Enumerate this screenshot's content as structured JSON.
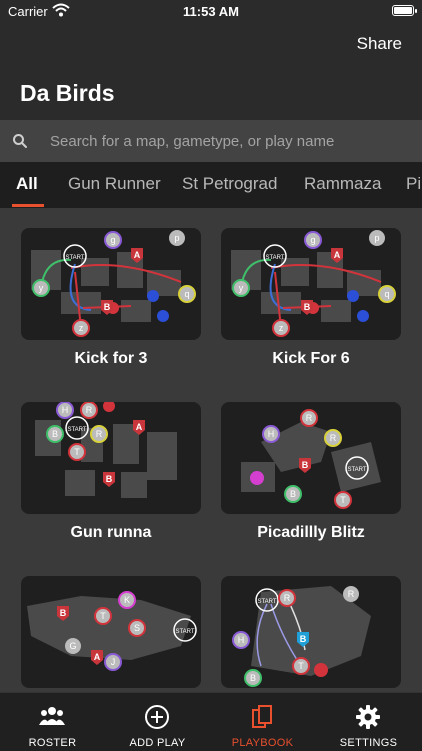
{
  "status_bar": {
    "carrier": "Carrier",
    "time": "11:53 AM",
    "battery_level": 0.9
  },
  "header": {
    "share_label": "Share",
    "title": "Da Birds"
  },
  "search": {
    "placeholder": "Search for a map, gametype, or play name"
  },
  "tabs": [
    {
      "label": "All",
      "active": true
    },
    {
      "label": "Gun Runner"
    },
    {
      "label": "St Petrograd"
    },
    {
      "label": "Rammaza"
    },
    {
      "label": "Pi"
    }
  ],
  "plays": [
    {
      "name": "Kick for 3",
      "markers": [
        "START",
        "A",
        "B",
        "g",
        "p",
        "q",
        "y",
        "z"
      ]
    },
    {
      "name": "Kick For 6",
      "markers": [
        "START",
        "A",
        "B",
        "g",
        "p",
        "q",
        "y",
        "z"
      ]
    },
    {
      "name": "Gun runna",
      "markers": [
        "H",
        "R",
        "START",
        "B",
        "T",
        "R",
        "A",
        "B"
      ]
    },
    {
      "name": "Picadillly Blitz",
      "markers": [
        "R",
        "H",
        "R",
        "B",
        "START",
        "B",
        "T"
      ]
    },
    {
      "name": "",
      "markers": [
        "B",
        "T",
        "K",
        "S",
        "START",
        "G",
        "A",
        "J"
      ]
    },
    {
      "name": "",
      "markers": [
        "START",
        "R",
        "R",
        "H",
        "B",
        "T",
        "B"
      ]
    }
  ],
  "tab_bar": [
    {
      "label": "ROSTER",
      "icon": "roster-icon"
    },
    {
      "label": "ADD PLAY",
      "icon": "add-play-icon"
    },
    {
      "label": "PLAYBOOK",
      "icon": "playbook-icon",
      "active": true
    },
    {
      "label": "SETTINGS",
      "icon": "gear-icon"
    }
  ],
  "colors": {
    "accent": "#e8502e",
    "background": "#3a3a3a",
    "header": "#2b2b2b",
    "objective": "#c8363c"
  }
}
